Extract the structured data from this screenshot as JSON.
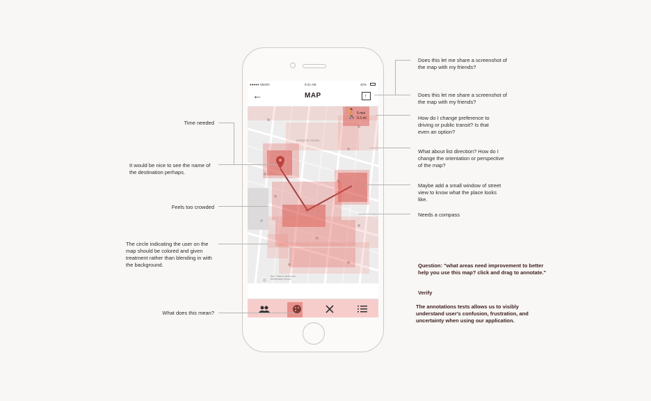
{
  "phone": {
    "status": {
      "carrier": "●●●●● Sketch",
      "time": "9:41 AM",
      "battery": "42%"
    },
    "nav_title": "MAP",
    "walk_badge": {
      "time": "5 min",
      "distance": "0.3 mi"
    },
    "map_labels": {
      "district": "HORACE MANN",
      "school": "Sen. Dianne McKinnon Elementary School"
    },
    "tabs": [
      {
        "name": "people"
      },
      {
        "name": "palette"
      },
      {
        "name": "food"
      },
      {
        "name": "list"
      }
    ]
  },
  "annotations": {
    "share_top": "Does this let me share a screenshot of the map with my friends?",
    "share_second": "Does this let me share a screenshot of the map with my friends?",
    "preference": "How do I change preference to driving or public transit? Is that even an option?",
    "direction": "What about list direction? How do I change the orientation or perspective of the map?",
    "street_view": "Maybe add a small window of street view to know what the place looks like.",
    "compass": "Needs a compass",
    "time_needed": "Time needed",
    "destination": "It would be nice to see the name of the destination perhaps.",
    "crowded": "Feels too crowded",
    "user_circle": "The circle indicating the user on the map should be colored and given treatment rather than blending in with the background.",
    "what_mean": "What does this mean?"
  },
  "study": {
    "question": "Question: \"what areas need improvement to better help you use this map? click and drag to annotate.\"",
    "verify_title": "Verify",
    "verify_body": "The annotations tests allows us to visibly understand user's confusion, frustration, and uncertainty when using our application."
  },
  "colors": {
    "heat": "#e25a52",
    "accent": "#3c1d1d",
    "route": "#8a3b39"
  }
}
